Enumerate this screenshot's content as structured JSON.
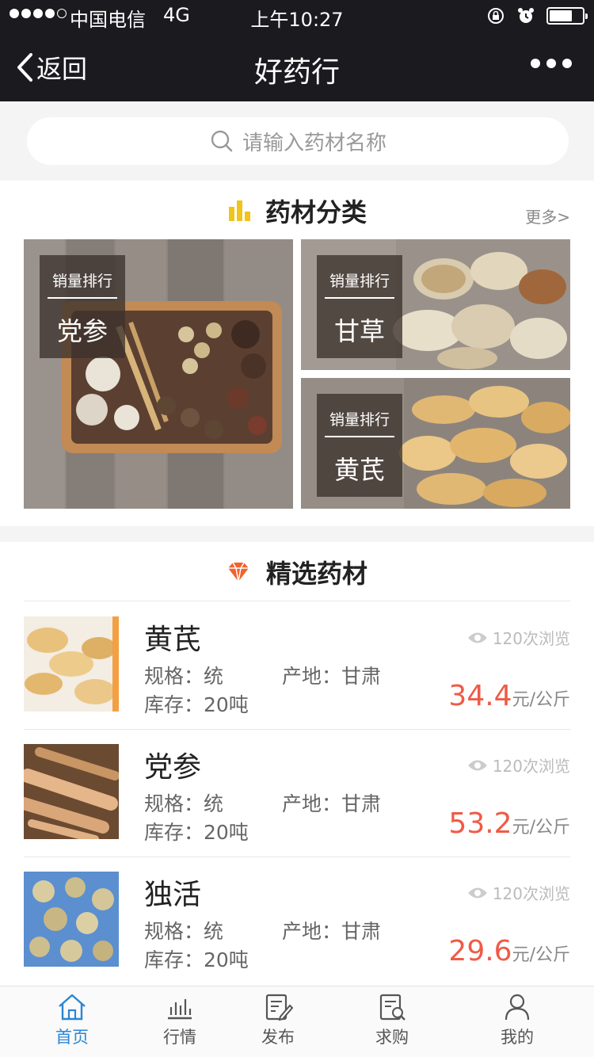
{
  "status_bar": {
    "carrier": "中国电信",
    "network": "4G",
    "time": "上午10:27"
  },
  "nav": {
    "back_label": "返回",
    "title": "好药行"
  },
  "search": {
    "placeholder": "请输入药材名称"
  },
  "categories": {
    "title": "药材分类",
    "more_label": "更多>",
    "tiles": [
      {
        "tag": "销量排行",
        "name": "党参"
      },
      {
        "tag": "销量排行",
        "name": "甘草"
      },
      {
        "tag": "销量排行",
        "name": "黄芪"
      }
    ]
  },
  "featured": {
    "title": "精选药材",
    "items": [
      {
        "name": "黄芪",
        "spec": "规格：统",
        "origin": "产地：甘肃",
        "stock": "库存：20吨",
        "views": "120次浏览",
        "price": "34.4",
        "unit": "元/公斤"
      },
      {
        "name": "党参",
        "spec": "规格：统",
        "origin": "产地：甘肃",
        "stock": "库存：20吨",
        "views": "120次浏览",
        "price": "53.2",
        "unit": "元/公斤"
      },
      {
        "name": "独活",
        "spec": "规格：统",
        "origin": "产地：甘肃",
        "stock": "库存：20吨",
        "views": "120次浏览",
        "price": "29.6",
        "unit": "元/公斤"
      }
    ]
  },
  "tab_bar": {
    "tabs": [
      {
        "label": "首页",
        "icon": "home-icon",
        "active": true
      },
      {
        "label": "行情",
        "icon": "chart-icon"
      },
      {
        "label": "发布",
        "icon": "edit-doc-icon"
      },
      {
        "label": "求购",
        "icon": "search-doc-icon"
      },
      {
        "label": "我的",
        "icon": "user-icon"
      }
    ]
  },
  "colors": {
    "accent_blue": "#2b86d4",
    "price_red": "#f05a46",
    "category_yellow": "#f0c419",
    "diamond_orange": "#f0642d",
    "header_dark": "#1b1b1f"
  }
}
